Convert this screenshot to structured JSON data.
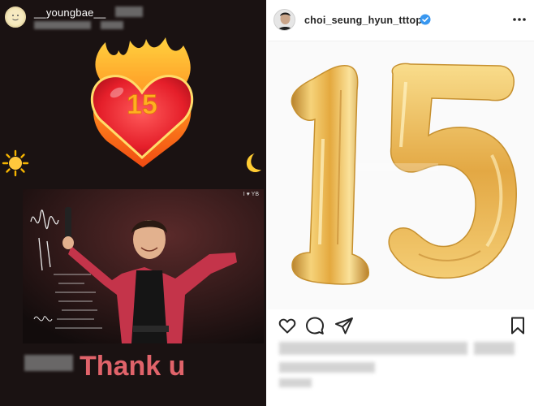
{
  "story": {
    "username": "__youngbae__",
    "heart_number": "15",
    "photo_watermark": "I ♥ YB",
    "message": "Thank u"
  },
  "post": {
    "username": "choi_seung_hyun_tttop",
    "verified": true,
    "balloon_text": "15",
    "icons": [
      "heart-icon",
      "comment-icon",
      "share-icon",
      "bookmark-icon",
      "more-icon",
      "verified-badge-icon"
    ]
  },
  "colors": {
    "story_background": "#1a1212",
    "thank_u_text": "#e0636a",
    "verified_blue": "#3897f0",
    "balloon_gold": "#e7b44c"
  }
}
